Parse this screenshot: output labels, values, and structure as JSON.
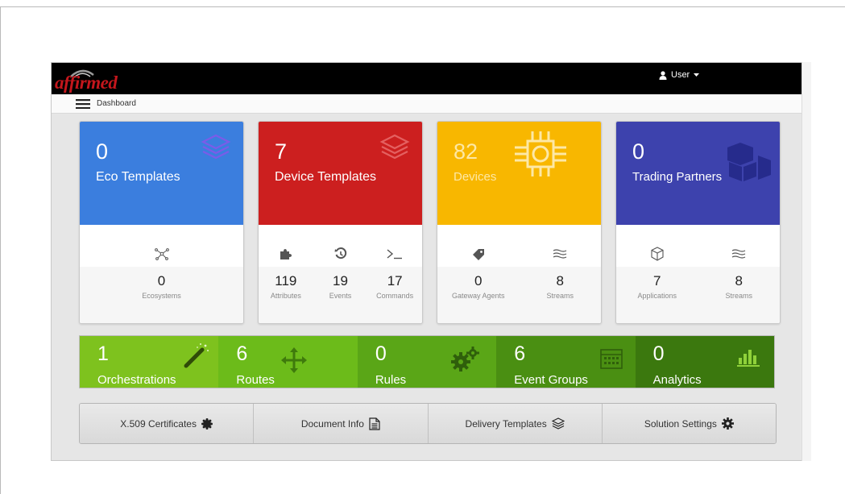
{
  "header": {
    "logo_text": "affirmed",
    "user_label": "User",
    "breadcrumb_title": "Dashboard"
  },
  "cards": [
    {
      "number": "0",
      "label": "Eco Templates",
      "color": "#3b7ede",
      "icon": "layers-icon",
      "stats": [
        {
          "icon": "network-icon",
          "value": "0",
          "label": "Ecosystems"
        }
      ]
    },
    {
      "number": "7",
      "label": "Device Templates",
      "color": "#cc1f1f",
      "icon": "layers-icon",
      "stats": [
        {
          "icon": "puzzle-icon",
          "value": "119",
          "label": "Attributes"
        },
        {
          "icon": "history-icon",
          "value": "19",
          "label": "Events"
        },
        {
          "icon": "terminal-icon",
          "value": "17",
          "label": "Commands"
        }
      ]
    },
    {
      "number": "82",
      "label": "Devices",
      "color": "#f8b700",
      "icon": "chip-icon",
      "stats": [
        {
          "icon": "tag-icon",
          "value": "0",
          "label": "Gateway Agents"
        },
        {
          "icon": "waves-icon",
          "value": "8",
          "label": "Streams"
        }
      ]
    },
    {
      "number": "0",
      "label": "Trading Partners",
      "color": "#3d42ad",
      "icon": "cubes-icon",
      "stats": [
        {
          "icon": "box-icon",
          "value": "7",
          "label": "Applications"
        },
        {
          "icon": "waves-icon",
          "value": "8",
          "label": "Streams"
        }
      ]
    }
  ],
  "tiles": [
    {
      "number": "1",
      "label": "Orchestrations",
      "color": "#7ec21e",
      "icon": "magic-wand-icon"
    },
    {
      "number": "6",
      "label": "Routes",
      "color": "#6cbb1a",
      "icon": "move-arrows-icon"
    },
    {
      "number": "0",
      "label": "Rules",
      "color": "#5aa617",
      "icon": "gears-icon"
    },
    {
      "number": "6",
      "label": "Event Groups",
      "color": "#4a8f12",
      "icon": "calendar-icon"
    },
    {
      "number": "0",
      "label": "Analytics",
      "color": "#3b780e",
      "icon": "bar-chart-icon"
    }
  ],
  "actions": [
    {
      "label": "X.509 Certificates",
      "icon": "certificate-icon"
    },
    {
      "label": "Document Info",
      "icon": "document-icon"
    },
    {
      "label": "Delivery Templates",
      "icon": "layers-icon"
    },
    {
      "label": "Solution Settings",
      "icon": "gear-icon"
    }
  ]
}
